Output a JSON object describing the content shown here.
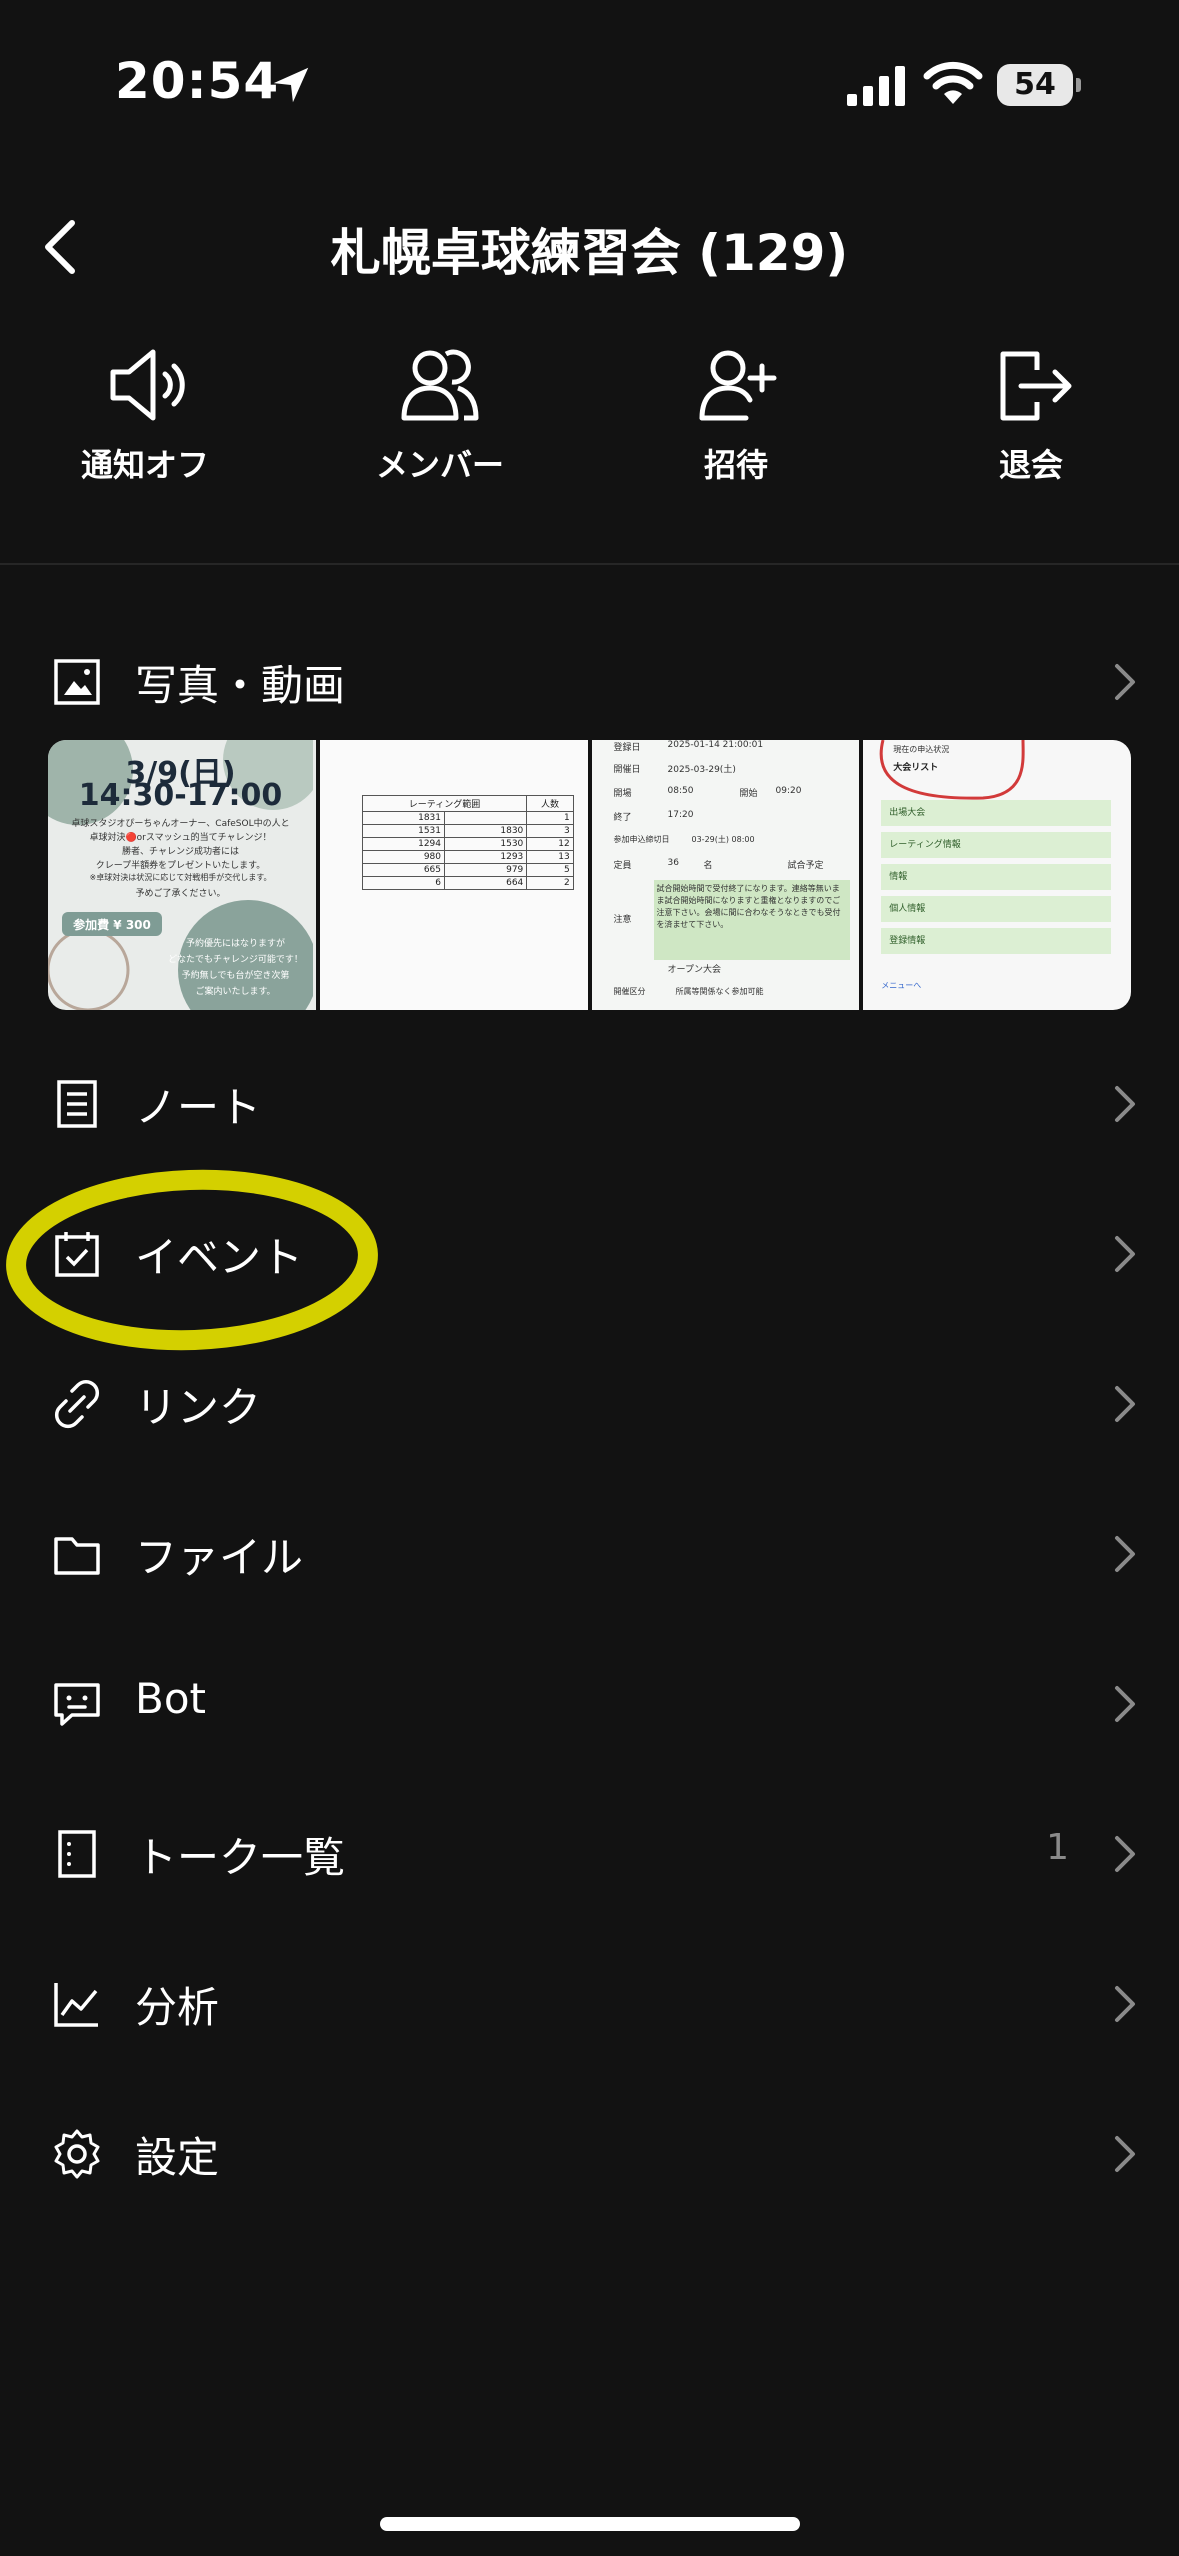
{
  "status_bar": {
    "time": "20:54",
    "battery": "54"
  },
  "header": {
    "title": "札幌卓球練習会 (129)"
  },
  "actions": [
    {
      "label": "通知オフ",
      "icon": "speaker-icon"
    },
    {
      "label": "メンバー",
      "icon": "members-icon"
    },
    {
      "label": "招待",
      "icon": "add-user-icon"
    },
    {
      "label": "退会",
      "icon": "leave-icon"
    }
  ],
  "menu": {
    "photos": "写真・動画",
    "notes": "ノート",
    "events": "イベント",
    "links": "リンク",
    "files": "ファイル",
    "bot": "Bot",
    "talk_list": "トーク一覧",
    "talk_list_count": "1",
    "analytics": "分析",
    "settings": "設定"
  },
  "photo_thumbs": {
    "t1": {
      "date": "3/9(日)",
      "time": "14:30-17:00",
      "lines": [
        "卓球スタジオぴーちゃんオーナー、CafeSOL中の人と",
        "卓球対決🔴orスマッシュ的当てチャレンジ！",
        "勝者、チャレンジ成功者には",
        "クレープ半額券をプレゼントいたします。",
        "※卓球対決は状況に応じて対戦相手が交代します。",
        "予めご了承ください。"
      ],
      "fee": "参加費 ¥ 300",
      "notes": [
        "予約優先にはなりますが",
        "どなたでもチャレンジ可能です！",
        "予約無しでも台が空き次第",
        "ご案内いたします。"
      ]
    },
    "t2": {
      "header_rating": "レーティング範囲",
      "header_count": "人数",
      "rows": [
        [
          "1831",
          "",
          "1"
        ],
        [
          "1531",
          "1830",
          "3"
        ],
        [
          "1294",
          "1530",
          "12"
        ],
        [
          "980",
          "1293",
          "13"
        ],
        [
          "665",
          "979",
          "5"
        ],
        [
          "6",
          "664",
          "2"
        ]
      ]
    },
    "t3": {
      "rows": [
        [
          "登録日",
          "2025-01-14 21:00:01"
        ],
        [
          "開催日",
          "2025-03-29(土)"
        ],
        [
          "開場",
          "08:50"
        ],
        [
          "終了",
          "17:20"
        ],
        [
          "参加申込締切日",
          "03-29(土) 08:00"
        ],
        [
          "定員",
          "36"
        ]
      ],
      "start_label": "開始",
      "start_value": "09:20",
      "unit": "名",
      "format": "試合予定",
      "note_label": "注意",
      "note": "試合開始時間で受付終了になります。連絡等無いまま試合開始時間になりますと重権となりますのでご注意下さい。会場に間に合わなそうなときでも受付を済ませて下さい。",
      "open_event": "オープン大会",
      "category_label": "開催区分",
      "category": "所属等関係なく参加可能"
    },
    "t4": {
      "status_label": "現在の申込状況",
      "list_label": "大会リスト",
      "menu_items": [
        "出場大会",
        "レーティング情報",
        "情報",
        "個人情報",
        "登録情報"
      ],
      "footer": "メニューへ"
    }
  },
  "colors": {
    "background": "#121212",
    "highlight": "#d4d000",
    "accent_green": "#cfe7c4"
  }
}
